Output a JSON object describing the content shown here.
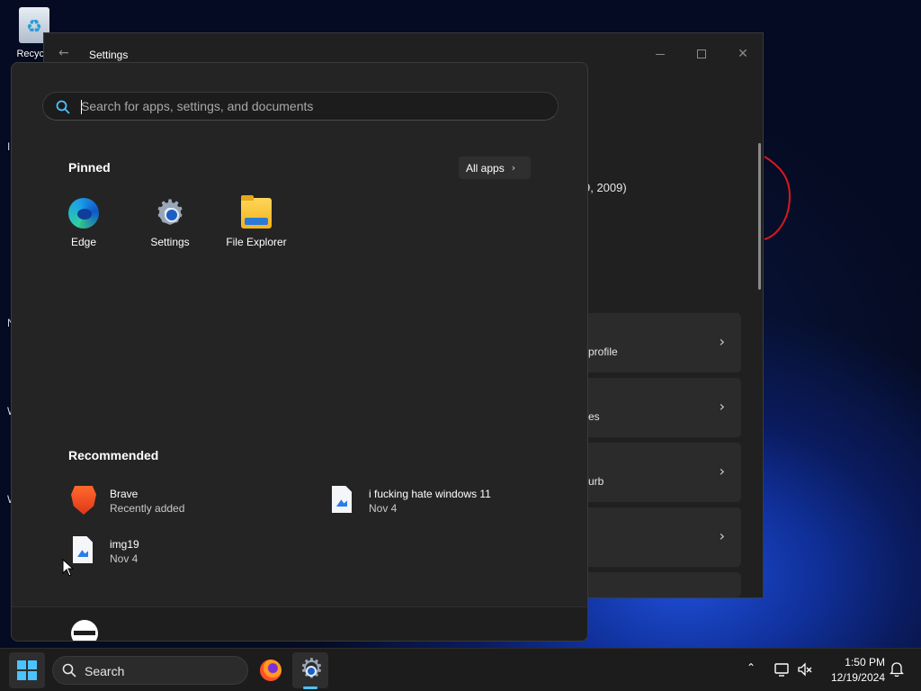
{
  "desktop": {
    "recycle_bin_label": "Recycle",
    "edge_letters": [
      "I",
      "N",
      "W",
      "W"
    ]
  },
  "settings_window": {
    "title": "Settings",
    "partial_text": "9, 2009)",
    "cards": [
      {
        "label": "profile"
      },
      {
        "label": "es"
      },
      {
        "label": "urb"
      },
      {
        "label": ""
      },
      {
        "label": ""
      }
    ]
  },
  "start_menu": {
    "search": {
      "placeholder": "Search for apps, settings, and documents",
      "value": ""
    },
    "pinned": {
      "title": "Pinned",
      "all_apps_label": "All apps",
      "apps": [
        {
          "label": "Edge",
          "icon": "edge-icon"
        },
        {
          "label": "Settings",
          "icon": "settings-gear-icon"
        },
        {
          "label": "File Explorer",
          "icon": "folder-icon"
        }
      ]
    },
    "recommended": {
      "title": "Recommended",
      "items": [
        {
          "name": "Brave",
          "sub": "Recently added",
          "icon": "brave-icon"
        },
        {
          "name": "i fucking hate windows 11",
          "sub": "Nov 4",
          "icon": "image-file-icon"
        },
        {
          "name": "img19",
          "sub": "Nov 4",
          "icon": "image-file-icon"
        }
      ]
    }
  },
  "taskbar": {
    "search_label": "Search",
    "time": "1:50 PM",
    "date": "12/19/2024",
    "accent": "#4cc2ff"
  }
}
